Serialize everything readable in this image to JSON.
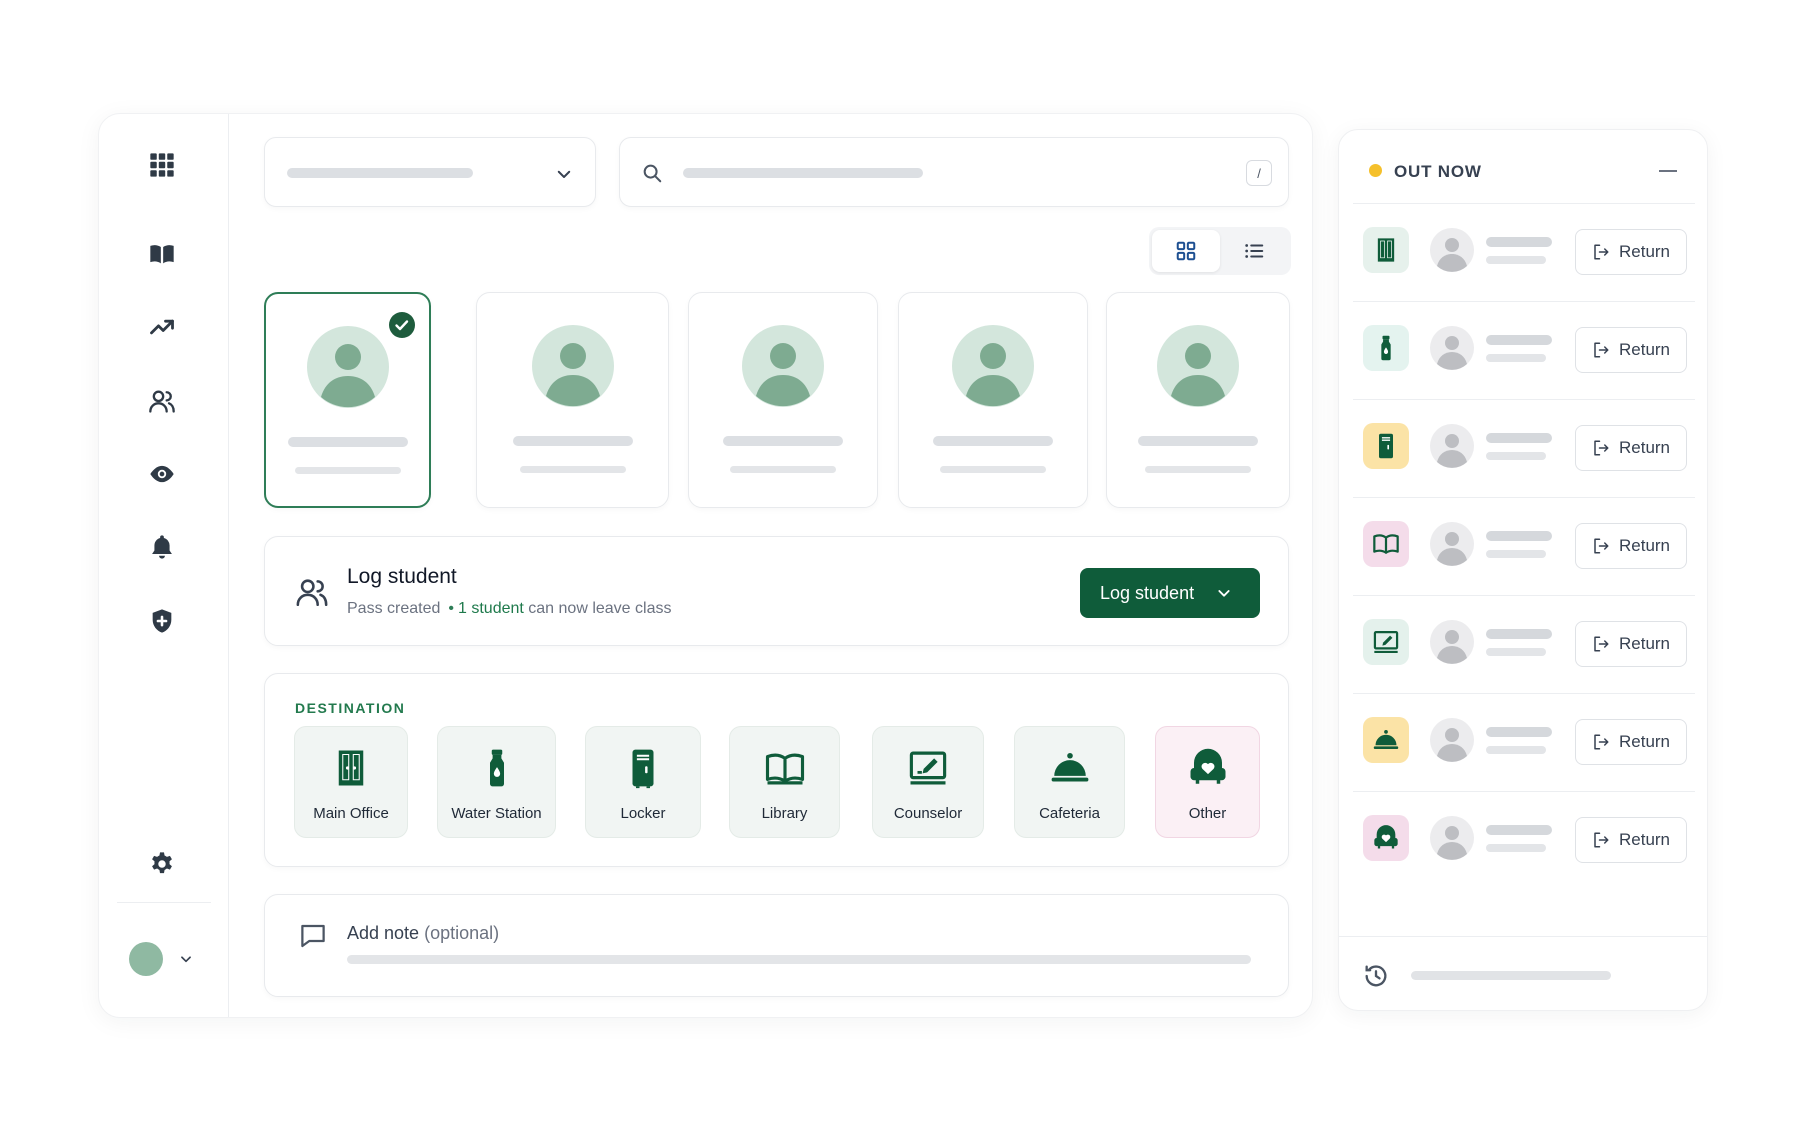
{
  "sidebar": {
    "icons": [
      "apps-grid-icon",
      "book-icon",
      "trending-icon",
      "users-icon",
      "eye-icon",
      "bell-icon",
      "shield-plus-icon",
      "gear-icon"
    ]
  },
  "search": {
    "shortcut": "/"
  },
  "view_toggle": {
    "active": "grid"
  },
  "students": {
    "count": 5,
    "selected_index": 0
  },
  "log_student": {
    "title": "Log student",
    "subtitle_prefix": "Pass created",
    "bullet": "•",
    "count_text": "1 student",
    "subtitle_suffix": "can now leave class",
    "button_label": "Log student"
  },
  "destination": {
    "label": "DESTINATION",
    "items": [
      {
        "label": "Main Office",
        "icon": "door-icon"
      },
      {
        "label": "Water Station",
        "icon": "water-bottle-icon"
      },
      {
        "label": "Locker",
        "icon": "locker-icon"
      },
      {
        "label": "Library",
        "icon": "open-book-icon"
      },
      {
        "label": "Counselor",
        "icon": "counselor-board-icon"
      },
      {
        "label": "Cafeteria",
        "icon": "cloche-icon"
      },
      {
        "label": "Other",
        "icon": "heart-chair-icon"
      }
    ]
  },
  "note": {
    "label": "Add note",
    "optional": "(optional)"
  },
  "out_now": {
    "title": "OUT NOW",
    "return_label": "Return",
    "rows": [
      {
        "icon": "door-icon",
        "bg": "#e6f1ec"
      },
      {
        "icon": "water-bottle-icon",
        "bg": "#e4f3ef"
      },
      {
        "icon": "locker-icon",
        "bg": "#fbe3a6"
      },
      {
        "icon": "open-book-icon",
        "bg": "#f4dcea"
      },
      {
        "icon": "counselor-board-icon",
        "bg": "#e4f1ec"
      },
      {
        "icon": "cloche-icon",
        "bg": "#fbe3a6"
      },
      {
        "icon": "heart-chair-icon",
        "bg": "#f4dcea"
      }
    ]
  },
  "colors": {
    "accent": "#0f5c3a",
    "status_dot": "#f5c02b"
  }
}
